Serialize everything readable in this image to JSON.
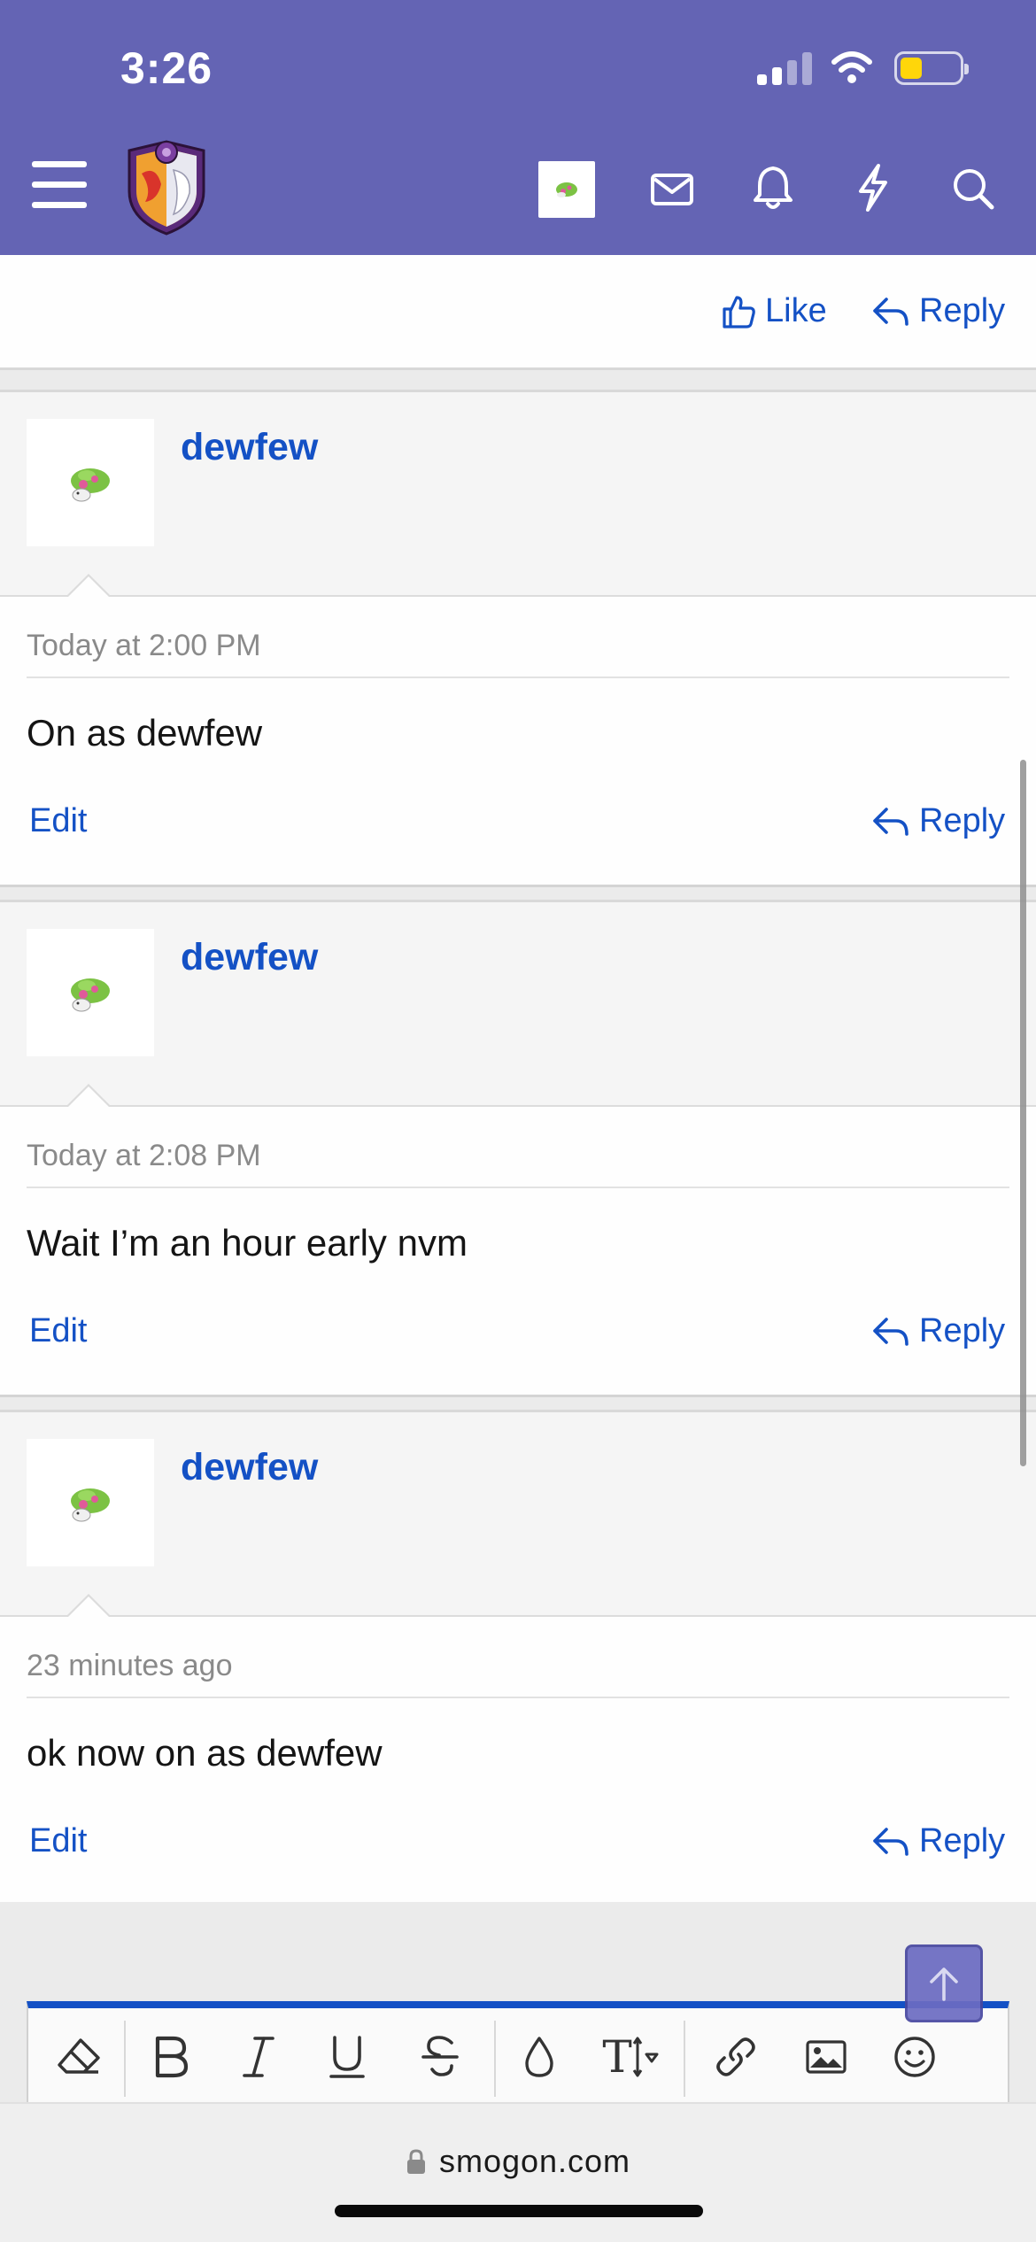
{
  "status_bar": {
    "time": "3:26"
  },
  "header": {
    "accent_color": "#6464b4",
    "icons": [
      "menu-icon",
      "site-logo",
      "user-avatar",
      "inbox-icon",
      "alerts-icon",
      "whats-new-icon",
      "search-icon"
    ]
  },
  "top_post": {
    "like_label": "Like",
    "reply_label": "Reply"
  },
  "posts": [
    {
      "username": "dewfew",
      "date": "Today at 2:00 PM",
      "text": "On as dewfew",
      "edit_label": "Edit",
      "reply_label": "Reply"
    },
    {
      "username": "dewfew",
      "date": "Today at 2:08 PM",
      "text": "Wait I’m an hour early nvm",
      "edit_label": "Edit",
      "reply_label": "Reply"
    },
    {
      "username": "dewfew",
      "date": "23 minutes ago",
      "text": "ok now on as dewfew",
      "edit_label": "Edit",
      "reply_label": "Reply"
    }
  ],
  "editor": {
    "tools": [
      "eraser-icon",
      "bold-icon",
      "italic-icon",
      "underline-icon",
      "strikethrough-icon",
      "text-color-icon",
      "font-size-icon",
      "link-icon",
      "image-icon",
      "emoji-icon"
    ],
    "font_size_glyph": "T",
    "accent_color": "#1451c5"
  },
  "browser": {
    "url": "smogon.com"
  }
}
